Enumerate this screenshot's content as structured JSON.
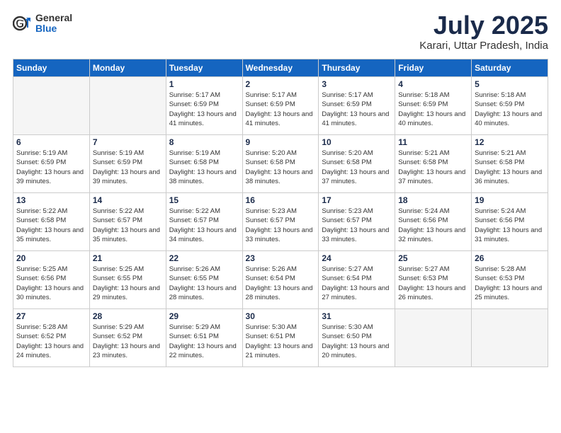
{
  "header": {
    "logo_general": "General",
    "logo_blue": "Blue",
    "month_title": "July 2025",
    "subtitle": "Karari, Uttar Pradesh, India"
  },
  "weekdays": [
    "Sunday",
    "Monday",
    "Tuesday",
    "Wednesday",
    "Thursday",
    "Friday",
    "Saturday"
  ],
  "weeks": [
    [
      {
        "day": "",
        "info": ""
      },
      {
        "day": "",
        "info": ""
      },
      {
        "day": "1",
        "info": "Sunrise: 5:17 AM\nSunset: 6:59 PM\nDaylight: 13 hours and 41 minutes."
      },
      {
        "day": "2",
        "info": "Sunrise: 5:17 AM\nSunset: 6:59 PM\nDaylight: 13 hours and 41 minutes."
      },
      {
        "day": "3",
        "info": "Sunrise: 5:17 AM\nSunset: 6:59 PM\nDaylight: 13 hours and 41 minutes."
      },
      {
        "day": "4",
        "info": "Sunrise: 5:18 AM\nSunset: 6:59 PM\nDaylight: 13 hours and 40 minutes."
      },
      {
        "day": "5",
        "info": "Sunrise: 5:18 AM\nSunset: 6:59 PM\nDaylight: 13 hours and 40 minutes."
      }
    ],
    [
      {
        "day": "6",
        "info": "Sunrise: 5:19 AM\nSunset: 6:59 PM\nDaylight: 13 hours and 39 minutes."
      },
      {
        "day": "7",
        "info": "Sunrise: 5:19 AM\nSunset: 6:59 PM\nDaylight: 13 hours and 39 minutes."
      },
      {
        "day": "8",
        "info": "Sunrise: 5:19 AM\nSunset: 6:58 PM\nDaylight: 13 hours and 38 minutes."
      },
      {
        "day": "9",
        "info": "Sunrise: 5:20 AM\nSunset: 6:58 PM\nDaylight: 13 hours and 38 minutes."
      },
      {
        "day": "10",
        "info": "Sunrise: 5:20 AM\nSunset: 6:58 PM\nDaylight: 13 hours and 37 minutes."
      },
      {
        "day": "11",
        "info": "Sunrise: 5:21 AM\nSunset: 6:58 PM\nDaylight: 13 hours and 37 minutes."
      },
      {
        "day": "12",
        "info": "Sunrise: 5:21 AM\nSunset: 6:58 PM\nDaylight: 13 hours and 36 minutes."
      }
    ],
    [
      {
        "day": "13",
        "info": "Sunrise: 5:22 AM\nSunset: 6:58 PM\nDaylight: 13 hours and 35 minutes."
      },
      {
        "day": "14",
        "info": "Sunrise: 5:22 AM\nSunset: 6:57 PM\nDaylight: 13 hours and 35 minutes."
      },
      {
        "day": "15",
        "info": "Sunrise: 5:22 AM\nSunset: 6:57 PM\nDaylight: 13 hours and 34 minutes."
      },
      {
        "day": "16",
        "info": "Sunrise: 5:23 AM\nSunset: 6:57 PM\nDaylight: 13 hours and 33 minutes."
      },
      {
        "day": "17",
        "info": "Sunrise: 5:23 AM\nSunset: 6:57 PM\nDaylight: 13 hours and 33 minutes."
      },
      {
        "day": "18",
        "info": "Sunrise: 5:24 AM\nSunset: 6:56 PM\nDaylight: 13 hours and 32 minutes."
      },
      {
        "day": "19",
        "info": "Sunrise: 5:24 AM\nSunset: 6:56 PM\nDaylight: 13 hours and 31 minutes."
      }
    ],
    [
      {
        "day": "20",
        "info": "Sunrise: 5:25 AM\nSunset: 6:56 PM\nDaylight: 13 hours and 30 minutes."
      },
      {
        "day": "21",
        "info": "Sunrise: 5:25 AM\nSunset: 6:55 PM\nDaylight: 13 hours and 29 minutes."
      },
      {
        "day": "22",
        "info": "Sunrise: 5:26 AM\nSunset: 6:55 PM\nDaylight: 13 hours and 28 minutes."
      },
      {
        "day": "23",
        "info": "Sunrise: 5:26 AM\nSunset: 6:54 PM\nDaylight: 13 hours and 28 minutes."
      },
      {
        "day": "24",
        "info": "Sunrise: 5:27 AM\nSunset: 6:54 PM\nDaylight: 13 hours and 27 minutes."
      },
      {
        "day": "25",
        "info": "Sunrise: 5:27 AM\nSunset: 6:53 PM\nDaylight: 13 hours and 26 minutes."
      },
      {
        "day": "26",
        "info": "Sunrise: 5:28 AM\nSunset: 6:53 PM\nDaylight: 13 hours and 25 minutes."
      }
    ],
    [
      {
        "day": "27",
        "info": "Sunrise: 5:28 AM\nSunset: 6:52 PM\nDaylight: 13 hours and 24 minutes."
      },
      {
        "day": "28",
        "info": "Sunrise: 5:29 AM\nSunset: 6:52 PM\nDaylight: 13 hours and 23 minutes."
      },
      {
        "day": "29",
        "info": "Sunrise: 5:29 AM\nSunset: 6:51 PM\nDaylight: 13 hours and 22 minutes."
      },
      {
        "day": "30",
        "info": "Sunrise: 5:30 AM\nSunset: 6:51 PM\nDaylight: 13 hours and 21 minutes."
      },
      {
        "day": "31",
        "info": "Sunrise: 5:30 AM\nSunset: 6:50 PM\nDaylight: 13 hours and 20 minutes."
      },
      {
        "day": "",
        "info": ""
      },
      {
        "day": "",
        "info": ""
      }
    ]
  ]
}
